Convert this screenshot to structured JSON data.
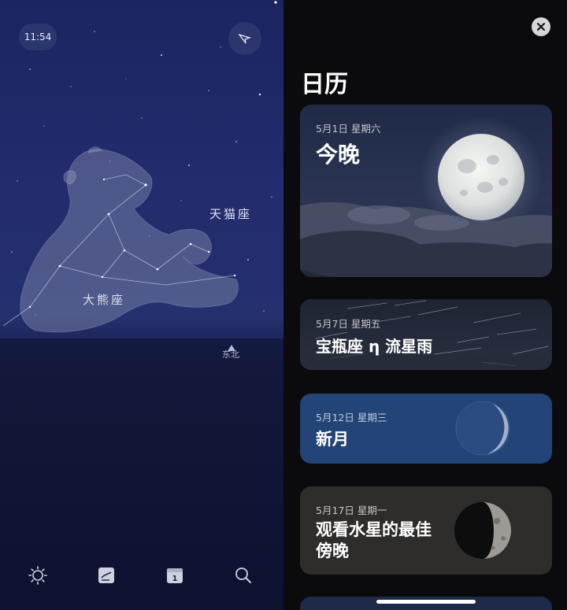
{
  "sky_view": {
    "time": "11:54",
    "constellations": {
      "ursa_major": "大熊座",
      "lynx": "天猫座"
    },
    "direction": "东北",
    "tabs": [
      {
        "icon": "sun-icon"
      },
      {
        "icon": "stories-icon"
      },
      {
        "icon": "calendar-icon",
        "badge": "1"
      },
      {
        "icon": "search-icon"
      }
    ]
  },
  "calendar": {
    "title": "日历",
    "events": [
      {
        "date": "5月1日 星期六",
        "title": "今晚"
      },
      {
        "date": "5月7日 星期五",
        "title": "宝瓶座 η 流星雨"
      },
      {
        "date": "5月12日 星期三",
        "title": "新月"
      },
      {
        "date": "5月17日 星期一",
        "title_line1": "观看水星的最佳",
        "title_line2": "傍晚"
      }
    ]
  },
  "colors": {
    "sky_top": "#1c2560",
    "panel_bg": "#0b0b0d",
    "new_moon_card": "#224476"
  }
}
